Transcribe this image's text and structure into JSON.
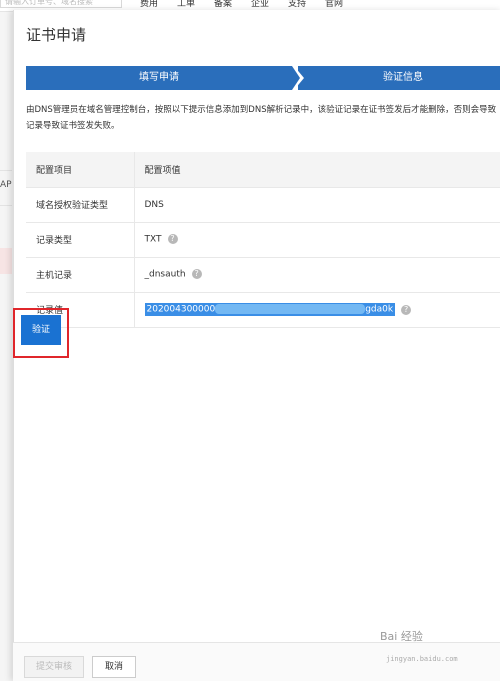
{
  "background": {
    "search_placeholder": "请输入订单号、域名搜索",
    "nav_items": [
      "费用",
      "工单",
      "备案",
      "企业",
      "支持",
      "官网"
    ],
    "left_label": "AP"
  },
  "dialog": {
    "title": "证书申请",
    "steps": [
      "填写申请",
      "验证信息"
    ],
    "description": "由DNS管理员在域名管理控制台，按照以下提示信息添加到DNS解析记录中，该验证记录在证书签发后才能删除，否则会导致记录导致证书签发失败。",
    "table": {
      "headers": [
        "配置项目",
        "配置项值"
      ],
      "rows": [
        {
          "label": "域名授权验证类型",
          "value": "DNS"
        },
        {
          "label": "记录类型",
          "value": "TXT"
        },
        {
          "label": "主机记录",
          "value": "_dnsauth"
        },
        {
          "label": "记录值",
          "value_prefix": "202004300000",
          "value_suffix": "gda0k"
        }
      ]
    },
    "verify_label": "验证",
    "submit_label": "提交审核",
    "cancel_label": "取消"
  },
  "watermark": {
    "text": "Bai 经验",
    "url": "jingyan.baidu.com"
  },
  "colors": {
    "accent": "#2a6ebb",
    "button": "#1a72d2",
    "highlight_box": "#e0262b",
    "selection": "#3a8ee6"
  }
}
